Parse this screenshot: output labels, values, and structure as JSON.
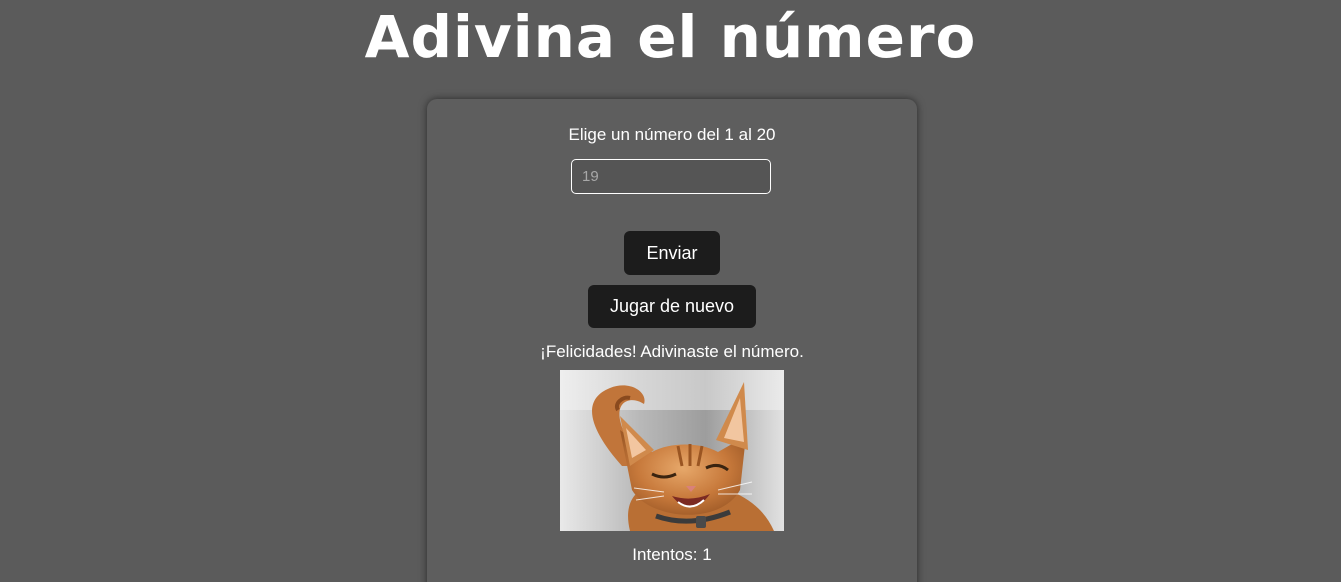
{
  "header": {
    "title": "Adivina el número"
  },
  "game": {
    "prompt": "Elige un número del 1 al 20",
    "input": {
      "value": "",
      "placeholder": "19"
    },
    "send_label": "Enviar",
    "replay_label": "Jugar de nuevo",
    "result_message": "¡Felicidades! Adivinaste el número.",
    "image_subject": "winking-cat-photo",
    "attempts_text": "Intentos: 1"
  },
  "colors": {
    "background": "#5b5b5b",
    "card": "#5e5e5e",
    "button": "#1c1c1c",
    "text": "#ffffff"
  }
}
